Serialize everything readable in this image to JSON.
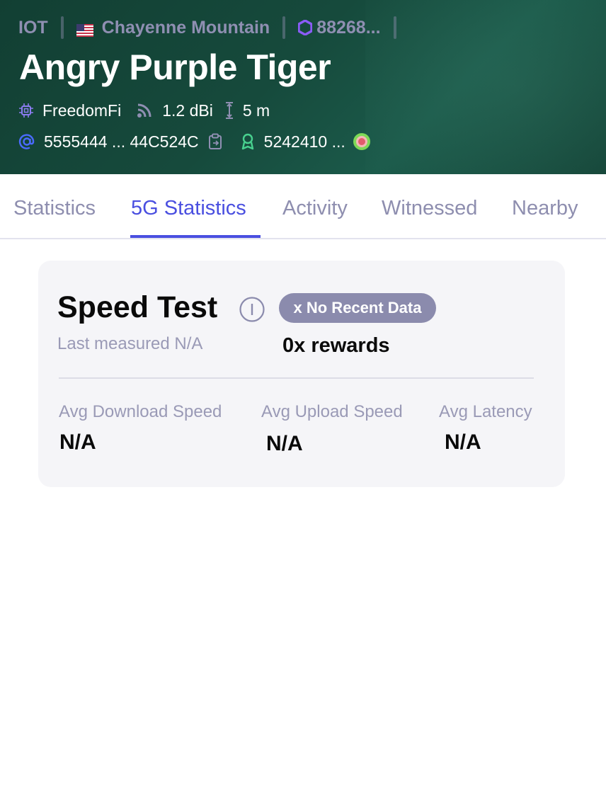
{
  "header": {
    "network": "IOT",
    "location": "Chayenne Mountain",
    "hex_id": "88268...",
    "title": "Angry Purple Tiger",
    "maker": "FreedomFi",
    "antenna_gain": "1.2 dBi",
    "elevation": "5 m",
    "address": "5555444 ... 44C524C",
    "owner": "5242410 ...",
    "colors": {
      "background": "#164a3c",
      "muted_text": "#8f8fb2",
      "hex_icon": "#8a5cf6",
      "address_icon": "#4a6bff",
      "owner_icon": "#48d18f",
      "status_dot": "#e25b6c"
    },
    "icons": {
      "flag": "us-flag-icon",
      "hex": "hexagon-icon",
      "maker": "chip-icon",
      "antenna": "signal-icon",
      "elevation": "elevation-icon",
      "address": "at-icon",
      "copy": "copy-icon",
      "owner": "person-icon",
      "status": "status-dot-icon"
    }
  },
  "tabs": [
    {
      "label": "Statistics",
      "active": false
    },
    {
      "label": "5G Statistics",
      "active": true
    },
    {
      "label": "Activity",
      "active": false
    },
    {
      "label": "Witnessed",
      "active": false
    },
    {
      "label": "Nearby",
      "active": false
    }
  ],
  "speed_test": {
    "title": "Speed Test",
    "badge": "x No Recent Data",
    "last_measured": "Last measured N/A",
    "rewards": "0x rewards",
    "stats": [
      {
        "label": "Avg Download Speed",
        "value": "N/A"
      },
      {
        "label": "Avg Upload Speed",
        "value": "N/A"
      },
      {
        "label": "Avg Latency",
        "value": "N/A"
      }
    ]
  }
}
